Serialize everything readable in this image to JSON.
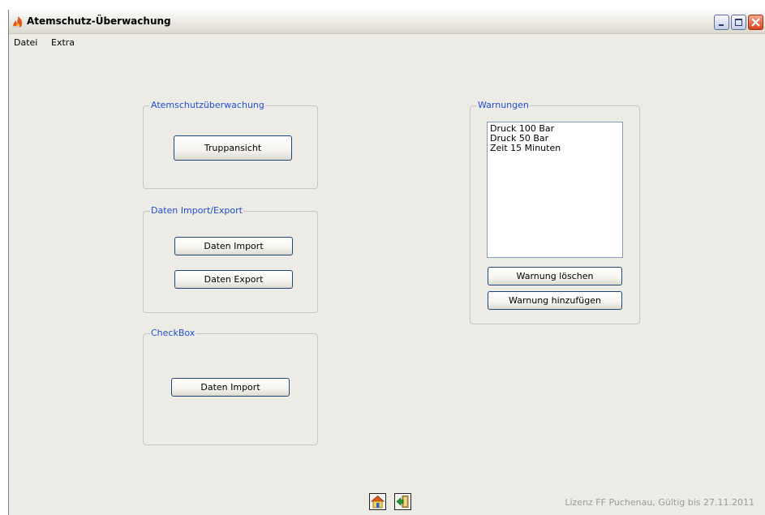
{
  "window": {
    "title": "Atemschutz-Überwachung"
  },
  "menu": {
    "items": [
      "Datei",
      "Extra"
    ]
  },
  "groups": {
    "atemschutz": {
      "legend": "Atemschutzüberwachung",
      "button": "Truppansicht"
    },
    "daten": {
      "legend": "Daten Import/Export",
      "import_button": "Daten Import",
      "export_button": "Daten Export"
    },
    "checkbox": {
      "legend": "CheckBox",
      "button": "Daten Import"
    },
    "warnungen": {
      "legend": "Warnungen",
      "items": [
        "Druck 100 Bar",
        "Druck 50 Bar",
        "Zeit 15 Minuten"
      ],
      "delete_button": "Warnung löschen",
      "add_button": "Warnung hinzufügen"
    }
  },
  "toolbar": {
    "icons": [
      "home-icon",
      "exit-door-icon"
    ]
  },
  "status": {
    "license": "Lizenz FF Puchenau, Gültig bis 27.11.2011"
  },
  "colors": {
    "window_bg": "#ecebe6",
    "legend_text": "#1f4fd0",
    "button_border": "#1f4675"
  }
}
